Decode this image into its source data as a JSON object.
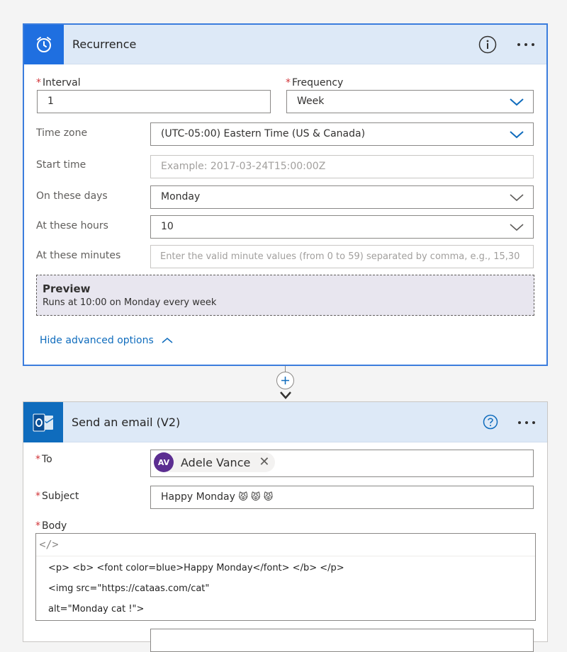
{
  "recurrence": {
    "title": "Recurrence",
    "interval": {
      "label": "Interval",
      "value": "1"
    },
    "frequency": {
      "label": "Frequency",
      "value": "Week"
    },
    "time_zone": {
      "label": "Time zone",
      "value": "(UTC-05:00) Eastern Time (US & Canada)"
    },
    "start_time": {
      "label": "Start time",
      "placeholder": "Example: 2017-03-24T15:00:00Z"
    },
    "on_these_days": {
      "label": "On these days",
      "value": "Monday"
    },
    "at_these_hours": {
      "label": "At these hours",
      "value": "10"
    },
    "at_these_minutes": {
      "label": "At these minutes",
      "placeholder": "Enter the valid minute values (from 0 to 59) separated by comma, e.g., 15,30"
    },
    "preview": {
      "title": "Preview",
      "text": "Runs at 10:00 on Monday every week"
    },
    "advanced_link": "Hide advanced options"
  },
  "email": {
    "title": "Send an email (V2)",
    "to": {
      "label": "To",
      "chip_initials": "AV",
      "chip_name": "Adele Vance",
      "remove": "✕"
    },
    "subject": {
      "label": "Subject",
      "value": "Happy Monday",
      "emoji": "😾 😾 😾"
    },
    "body": {
      "label": "Body",
      "code_icon": "</>",
      "lines": [
        "<p> <b> <font color=blue>Happy Monday</font> </b> </p>",
        "<img src=\"https://cataas.com/cat\"",
        "alt=\"Monday cat !\">"
      ]
    }
  },
  "colors": {
    "accent": "#1f6fe0",
    "header_bg": "#dde9f7",
    "required": "#d13438",
    "link": "#0f6cbd",
    "avatar": "#5c2e91"
  }
}
